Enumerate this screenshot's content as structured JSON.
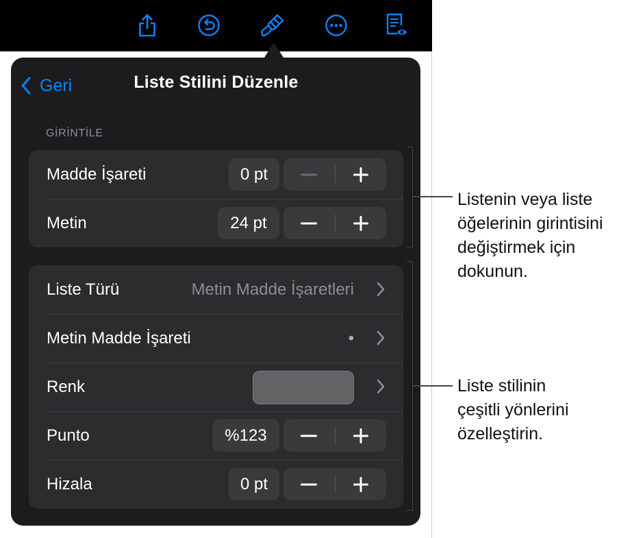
{
  "toolbar": {
    "icons": [
      "share-icon",
      "undo-icon",
      "format-brush-icon",
      "more-icon",
      "reader-view-icon"
    ]
  },
  "nav": {
    "back_label": "Geri",
    "title": "Liste Stilini Düzenle"
  },
  "indent_section": {
    "header": "GİRİNTİLE",
    "rows": [
      {
        "label": "Madde İşareti",
        "value": "0 pt",
        "minus": "−",
        "plus": "+"
      },
      {
        "label": "Metin",
        "value": "24 pt",
        "minus": "−",
        "plus": "+"
      }
    ]
  },
  "style_section": {
    "list_type": {
      "label": "Liste Türü",
      "value": "Metin Madde İşaretleri"
    },
    "text_bullet": {
      "label": "Metin Madde İşareti",
      "value": "•"
    },
    "color": {
      "label": "Renk",
      "swatch": "#636366"
    },
    "size": {
      "label": "Punto",
      "value": "%123",
      "minus": "−",
      "plus": "+"
    },
    "align": {
      "label": "Hizala",
      "value": "0 pt",
      "minus": "−",
      "plus": "+"
    }
  },
  "callouts": {
    "indent": "Listenin veya liste\nöğelerinin girintisini\ndeğiştirmek için\ndokunun.",
    "style": "Liste stilinin\nçeşitli yönlerini\nözelleştirin."
  },
  "colors": {
    "accent": "#0a84ff",
    "panel": "#1c1c1e",
    "group": "#2c2c2e",
    "control": "#3a3a3c"
  }
}
